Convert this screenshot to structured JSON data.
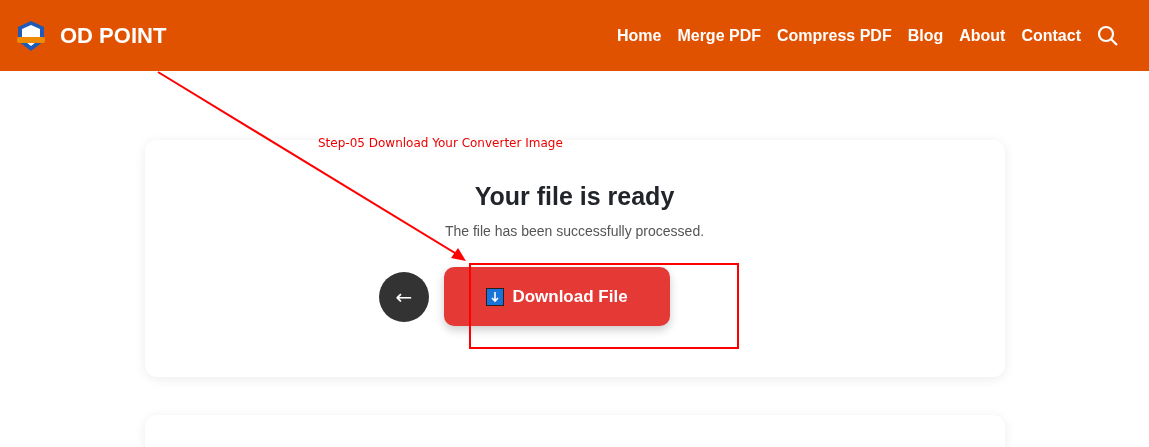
{
  "header": {
    "brand": "OD POINT",
    "nav": [
      "Home",
      "Merge PDF",
      "Compress PDF",
      "Blog",
      "About",
      "Contact"
    ]
  },
  "annotation": {
    "text": "Step-05 Download Your Converter Image"
  },
  "result": {
    "title": "Your file is ready",
    "message": "The file has been successfully processed.",
    "back_label": "←",
    "download_label": "Download File"
  }
}
